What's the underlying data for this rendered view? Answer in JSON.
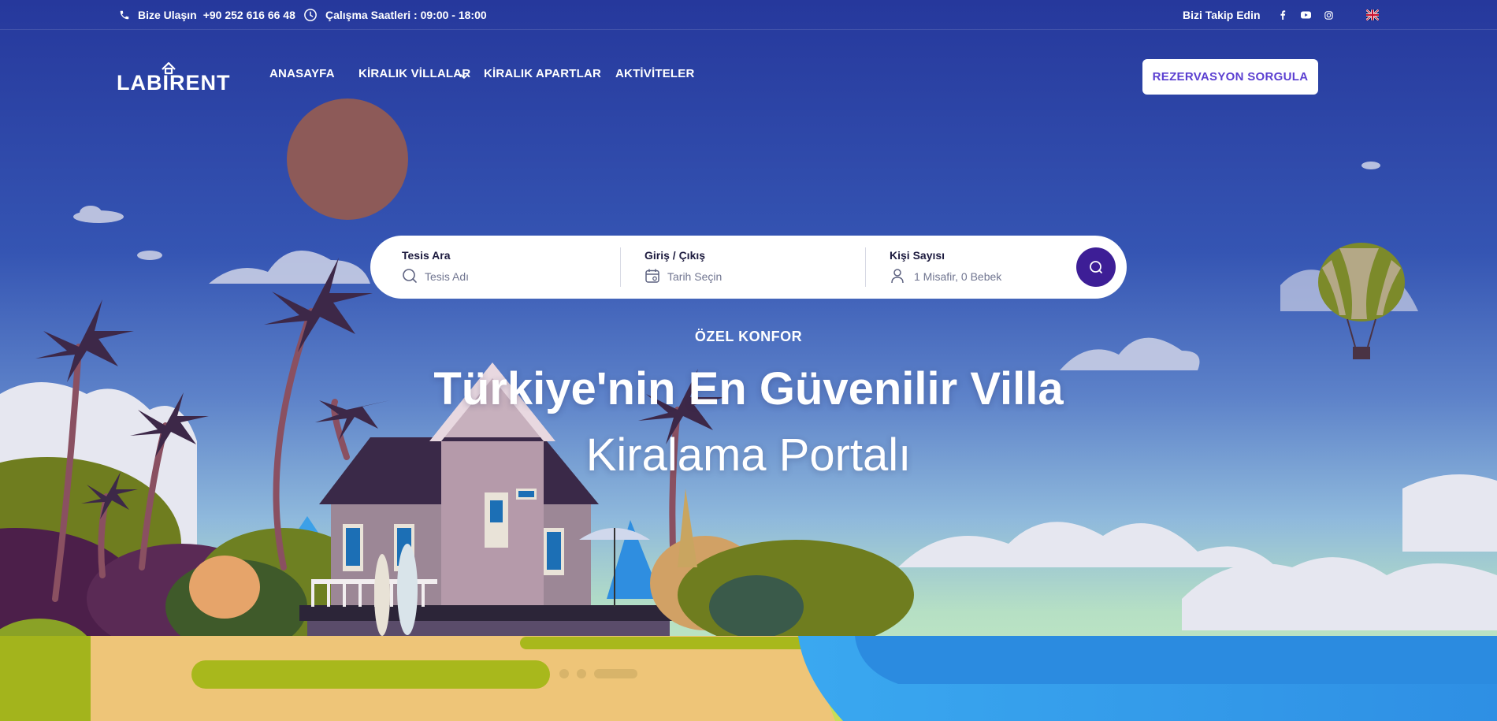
{
  "topbar": {
    "contact_label": "Bize Ulaşın",
    "phone": "+90 252 616 66 48",
    "hours": "Çalışma Saatleri : 09:00 - 18:00",
    "follow_label": "Bizi Takip Edin",
    "social": [
      {
        "icon": "facebook-icon"
      },
      {
        "icon": "youtube-icon"
      },
      {
        "icon": "instagram-icon"
      }
    ],
    "language_flag": "uk-flag-icon"
  },
  "brand": {
    "logo_text": "LABIRENT"
  },
  "nav": {
    "items": [
      {
        "label": "ANASAYFA"
      },
      {
        "label": "KİRALIK VİLLALAR",
        "has_dropdown": true
      },
      {
        "label": "KİRALIK APARTLAR"
      },
      {
        "label": "AKTİVİTELER"
      }
    ],
    "cta_label": "REZERVASYON SORGULA"
  },
  "search": {
    "facility_label": "Tesis Ara",
    "facility_placeholder": "Tesis Adı",
    "date_label": "Giriş / Çıkış",
    "date_placeholder": "Tarih Seçin",
    "guests_label": "Kişi Sayısı",
    "guests_value": "1 Misafir, 0 Bebek"
  },
  "hero": {
    "kicker": "ÖZEL KONFOR",
    "title_line1": "Türkiye'nin En Güvenilir Villa",
    "title_line2": "Kiralama Portalı",
    "slide_count": 3,
    "active_slide": 3
  },
  "colors": {
    "sky_top": "#2a3fa3",
    "sky_mid": "#4f71c6",
    "sea": "#2f96e6",
    "sand": "#eec578",
    "grass": "#a8b81c",
    "accent_button": "#3d1e96",
    "cta_text": "#5b3fd1"
  }
}
